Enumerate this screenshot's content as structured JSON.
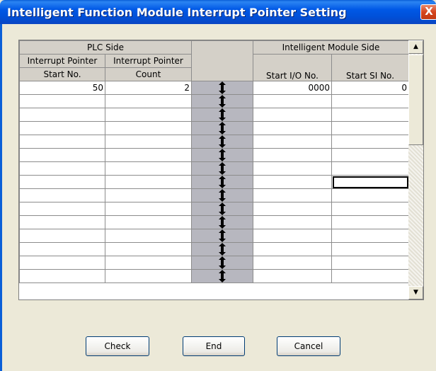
{
  "window": {
    "title": "Intelligent Function Module Interrupt Pointer Setting",
    "close_glyph": "X"
  },
  "table": {
    "group_headers": {
      "plc_side": "PLC Side",
      "module_side": "Intelligent Module Side"
    },
    "columns": {
      "interrupt_start_line1": "Interrupt Pointer",
      "interrupt_start_line2": "Start No.",
      "interrupt_count_line1": "Interrupt Pointer",
      "interrupt_count_line2": "Count",
      "start_io": "Start I/O No.",
      "start_si": "Start SI No."
    },
    "rows": [
      {
        "start_no": "50",
        "count": "2",
        "start_io": "0000",
        "start_si": "0"
      },
      {
        "start_no": "",
        "count": "",
        "start_io": "",
        "start_si": ""
      },
      {
        "start_no": "",
        "count": "",
        "start_io": "",
        "start_si": ""
      },
      {
        "start_no": "",
        "count": "",
        "start_io": "",
        "start_si": ""
      },
      {
        "start_no": "",
        "count": "",
        "start_io": "",
        "start_si": ""
      },
      {
        "start_no": "",
        "count": "",
        "start_io": "",
        "start_si": ""
      },
      {
        "start_no": "",
        "count": "",
        "start_io": "",
        "start_si": ""
      },
      {
        "start_no": "",
        "count": "",
        "start_io": "",
        "start_si": ""
      },
      {
        "start_no": "",
        "count": "",
        "start_io": "",
        "start_si": ""
      },
      {
        "start_no": "",
        "count": "",
        "start_io": "",
        "start_si": ""
      },
      {
        "start_no": "",
        "count": "",
        "start_io": "",
        "start_si": ""
      },
      {
        "start_no": "",
        "count": "",
        "start_io": "",
        "start_si": ""
      },
      {
        "start_no": "",
        "count": "",
        "start_io": "",
        "start_si": ""
      },
      {
        "start_no": "",
        "count": "",
        "start_io": "",
        "start_si": ""
      },
      {
        "start_no": "",
        "count": "",
        "start_io": "",
        "start_si": ""
      }
    ],
    "mapping_icon": "double-arrow-icon",
    "selected_row": 7
  },
  "scrollbar": {
    "up_glyph": "▲",
    "down_glyph": "▼"
  },
  "buttons": {
    "check": "Check",
    "end": "End",
    "cancel": "Cancel"
  },
  "colors": {
    "title_bar": "#0058E6",
    "dialog_bg": "#ECE9D8",
    "header_bg": "#D4D0C8",
    "mapping_column": "#B7B7BF"
  }
}
